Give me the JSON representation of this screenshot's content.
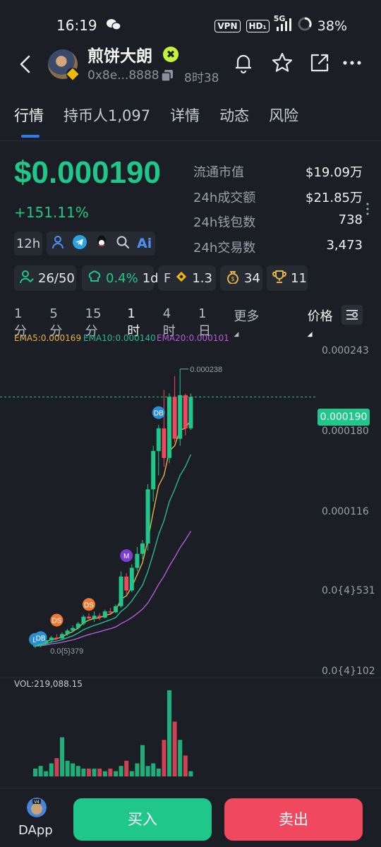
{
  "status_bar": {
    "time": "16:19",
    "wechat_icon": "wechat-icon",
    "vpn": "VPN",
    "hd": "HD₁",
    "network": "5G",
    "battery": "38%"
  },
  "header": {
    "token_name": "煎饼大朗",
    "verified_mark": "✖",
    "address": "0x8e...8888",
    "age": "8时38"
  },
  "tabs": [
    "行情",
    "持币人1,097",
    "详情",
    "动态",
    "风险"
  ],
  "price": {
    "value": "$0.000190",
    "change": "+151.11%"
  },
  "tags": {
    "period": "12h",
    "ai": "Ai"
  },
  "stats": [
    {
      "label": "流通市值",
      "value": "$19.09万"
    },
    {
      "label": "24h成交额",
      "value": "$21.85万"
    },
    {
      "label": "24h钱包数",
      "value": "738"
    },
    {
      "label": "24h交易数",
      "value": "3,473"
    }
  ],
  "chips": {
    "holders": "26/50",
    "top_pct": "0.4%",
    "top_period": "1d",
    "f_label": "F",
    "f_value": "1.3",
    "bags": "34",
    "trophy": "11"
  },
  "intervals": [
    "1分",
    "5分",
    "15分",
    "1时",
    "4时",
    "1日",
    "更多",
    "价格"
  ],
  "active_interval": "1时",
  "ema": {
    "ema5": "EMA5:0.000169",
    "ema10": "EMA10:0.000140",
    "ema20": "EMA20:0.000101"
  },
  "chart_data": {
    "type": "candlestick",
    "y_ticks": [
      "0.000243",
      "0.000180",
      "0.000116",
      "0.0{4}531",
      "0.0{4}102"
    ],
    "current_price_tag": "0.000190",
    "high_label": "0.000238",
    "low_label": "0.0{5}379",
    "markers": [
      "D",
      "DB",
      "DS",
      "DS",
      "M",
      "DB"
    ],
    "candles": [
      {
        "o": 5,
        "h": 6,
        "l": 4,
        "c": 5.5
      },
      {
        "o": 5.5,
        "h": 7,
        "l": 4.5,
        "c": 6.5
      },
      {
        "o": 6.5,
        "h": 9,
        "l": 5.5,
        "c": 8.5
      },
      {
        "o": 8.5,
        "h": 11,
        "l": 7,
        "c": 10
      },
      {
        "o": 10,
        "h": 12,
        "l": 9,
        "c": 9.5
      },
      {
        "o": 9.5,
        "h": 13,
        "l": 9,
        "c": 12
      },
      {
        "o": 12,
        "h": 15,
        "l": 11,
        "c": 14
      },
      {
        "o": 14,
        "h": 17,
        "l": 13,
        "c": 15.5
      },
      {
        "o": 15.5,
        "h": 19,
        "l": 14.5,
        "c": 18
      },
      {
        "o": 18,
        "h": 23,
        "l": 17,
        "c": 22
      },
      {
        "o": 22,
        "h": 24,
        "l": 20,
        "c": 21
      },
      {
        "o": 21,
        "h": 25,
        "l": 19,
        "c": 22.5
      },
      {
        "o": 22.5,
        "h": 24,
        "l": 20,
        "c": 21.5
      },
      {
        "o": 21.5,
        "h": 26,
        "l": 21,
        "c": 25
      },
      {
        "o": 25,
        "h": 27,
        "l": 24,
        "c": 24.5
      },
      {
        "o": 24.5,
        "h": 29,
        "l": 24,
        "c": 28
      },
      {
        "o": 28,
        "h": 48,
        "l": 27,
        "c": 45
      },
      {
        "o": 45,
        "h": 47,
        "l": 35,
        "c": 37
      },
      {
        "o": 37,
        "h": 52,
        "l": 36,
        "c": 50
      },
      {
        "o": 50,
        "h": 62,
        "l": 48,
        "c": 58
      },
      {
        "o": 58,
        "h": 66,
        "l": 55,
        "c": 64
      },
      {
        "o": 64,
        "h": 98,
        "l": 60,
        "c": 95
      },
      {
        "o": 95,
        "h": 120,
        "l": 88,
        "c": 117
      },
      {
        "o": 117,
        "h": 132,
        "l": 103,
        "c": 130
      },
      {
        "o": 130,
        "h": 152,
        "l": 108,
        "c": 113
      },
      {
        "o": 113,
        "h": 150,
        "l": 110,
        "c": 148
      },
      {
        "o": 148,
        "h": 160,
        "l": 122,
        "c": 124
      },
      {
        "o": 124,
        "h": 164,
        "l": 120,
        "c": 149
      },
      {
        "o": 149,
        "h": 150,
        "l": 126,
        "c": 130
      },
      {
        "o": 130,
        "h": 150,
        "l": 129,
        "c": 148
      }
    ],
    "ema5": [
      5.3,
      6,
      7.5,
      9,
      9.3,
      10.5,
      12,
      13.5,
      15.5,
      18.5,
      20,
      21,
      21.3,
      22.7,
      23.5,
      25.5,
      32,
      34,
      39,
      46,
      53,
      66,
      82,
      97,
      103,
      117,
      120,
      129,
      130,
      135
    ],
    "ema10": [
      5.2,
      5.6,
      6.5,
      7.5,
      8,
      8.8,
      9.9,
      11,
      12.6,
      14.5,
      15.8,
      17,
      18,
      19.1,
      20.2,
      21.5,
      25,
      27.5,
      31,
      35.5,
      40,
      48,
      58,
      69,
      77,
      88,
      95,
      103,
      108,
      115
    ],
    "ema20": [
      5.1,
      5.3,
      5.8,
      6.4,
      6.8,
      7.3,
      8,
      8.7,
      9.6,
      10.8,
      11.7,
      12.6,
      13.4,
      14.3,
      15.1,
      16.1,
      18,
      19.6,
      21.5,
      23.8,
      26.3,
      29.9,
      34.9,
      40.5,
      45.2,
      51,
      56,
      61.5,
      66,
      71
    ],
    "volumes": [
      3,
      4,
      2,
      5,
      7,
      15,
      6,
      5,
      4,
      3,
      3,
      3,
      3,
      2,
      3,
      2,
      4,
      6,
      2,
      5,
      12,
      4,
      5,
      3,
      14,
      33,
      21,
      14,
      8,
      2
    ],
    "volume_label": "VOL:219,088.15"
  },
  "bottom": {
    "dapp_label": "DApp",
    "dapp_badge": "V4",
    "buy_label": "买入",
    "sell_label": "卖出"
  },
  "colors": {
    "up": "#1fc88a",
    "down": "#f0485e",
    "ema5": "#e5b34a",
    "ema10": "#2bb894",
    "ema20": "#b35cd6"
  }
}
